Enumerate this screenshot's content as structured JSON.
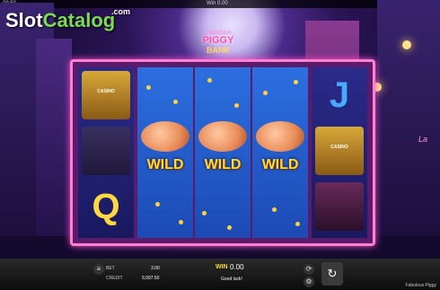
{
  "topbar": {
    "left": "09:50",
    "center": "Win 0.00",
    "right": "Be"
  },
  "watermark": {
    "slot": "Slot",
    "catalog": "Catalog",
    "com": ".com"
  },
  "logo": {
    "line1": "Fabulous",
    "line2": "PIGGY",
    "line3": "BANK"
  },
  "reels": {
    "reel1": [
      "Casino",
      "Pig Boss",
      "Q"
    ],
    "reel2": "WILD",
    "reel3": "WILD",
    "reel4": "WILD",
    "reel5": [
      "J",
      "Casino",
      "Lady"
    ]
  },
  "symbol_labels": {
    "casino": "CASINO"
  },
  "bottom": {
    "bet_label": "BET",
    "bet_value": "3.00",
    "credit_label": "CREDIT",
    "credit_value": "9,997.50",
    "win_label": "WIN",
    "win_value": "0.00",
    "message": "Good luck!",
    "game_name": "Fabulous Piggy"
  },
  "neon_sign": "La",
  "icons": {
    "settings": "gear-icon",
    "spin": "spin-icon",
    "autoplay": "autoplay-icon",
    "stack": "coin-stack-icon"
  }
}
